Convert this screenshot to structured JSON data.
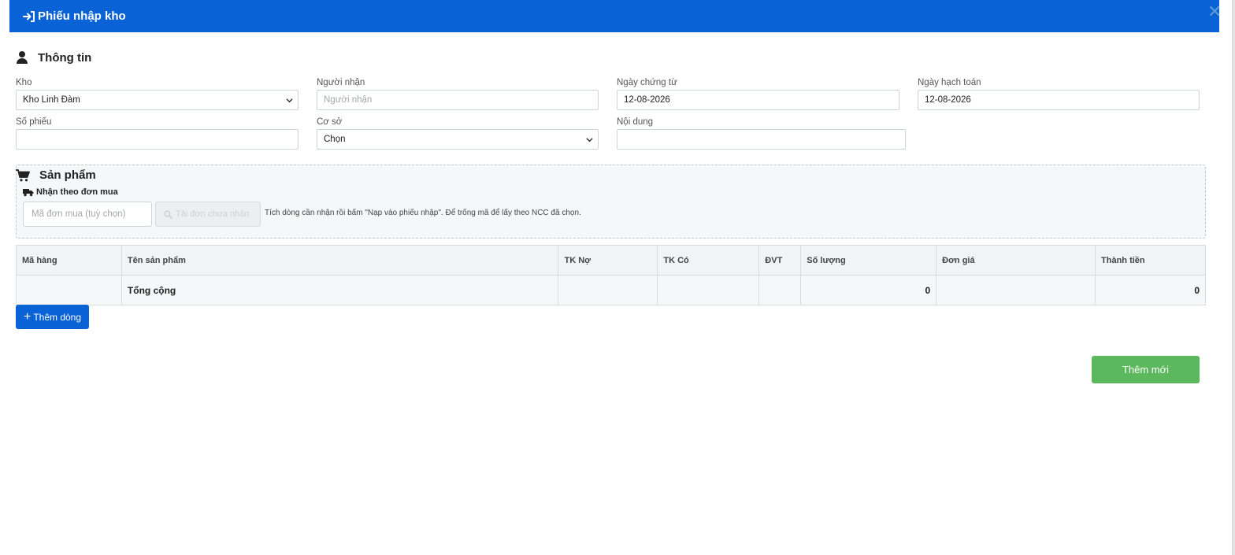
{
  "header": {
    "title": "Phiếu nhập kho",
    "close_glyph": "✕",
    "icon": "sign-in-icon",
    "color": "#0a63d6"
  },
  "info": {
    "title": "Thông tin",
    "icon": "user-icon",
    "fields": {
      "kho": {
        "label": "Kho",
        "value": "Kho Linh Đàm"
      },
      "nguoi_nhan": {
        "label": "Người nhận",
        "placeholder": "Người nhận",
        "value": ""
      },
      "ngay_chung_tu": {
        "label": "Ngày chứng từ",
        "value": "12-08-2026"
      },
      "ngay_hach_toan": {
        "label": "Ngày hạch toán",
        "value": "12-08-2026"
      },
      "so_phieu": {
        "label": "Số phiếu",
        "value": ""
      },
      "co_so": {
        "label": "Cơ sở",
        "value": "Chọn"
      },
      "noi_dung": {
        "label": "Nội dung",
        "value": ""
      }
    }
  },
  "products": {
    "title": "Sản phẩm",
    "icon": "cart-icon",
    "po": {
      "label": "Nhận theo đơn mua",
      "icon": "truck-icon",
      "input_placeholder": "Mã đơn mua (tuỳ chọn)",
      "button_label": "Tải đơn chưa nhận",
      "button_icon": "search-icon",
      "hint": "Tích dòng cần nhận rồi bấm \"Nạp vào phiếu nhập\". Để trống mã để lấy theo NCC đã chọn."
    },
    "columns": [
      "Mã hàng",
      "Tên sản phẩm",
      "TK Nợ",
      "TK Có",
      "ĐVT",
      "Số lượng",
      "Đơn giá",
      "Thành tiền"
    ],
    "total_row": {
      "label": "Tổng cộng",
      "so_luong": "0",
      "thanh_tien": "0"
    }
  },
  "actions": {
    "add_row": "Thêm dòng",
    "add_row_icon": "plus-icon",
    "submit": "Thêm mới",
    "submit_color": "#5cb85c"
  }
}
